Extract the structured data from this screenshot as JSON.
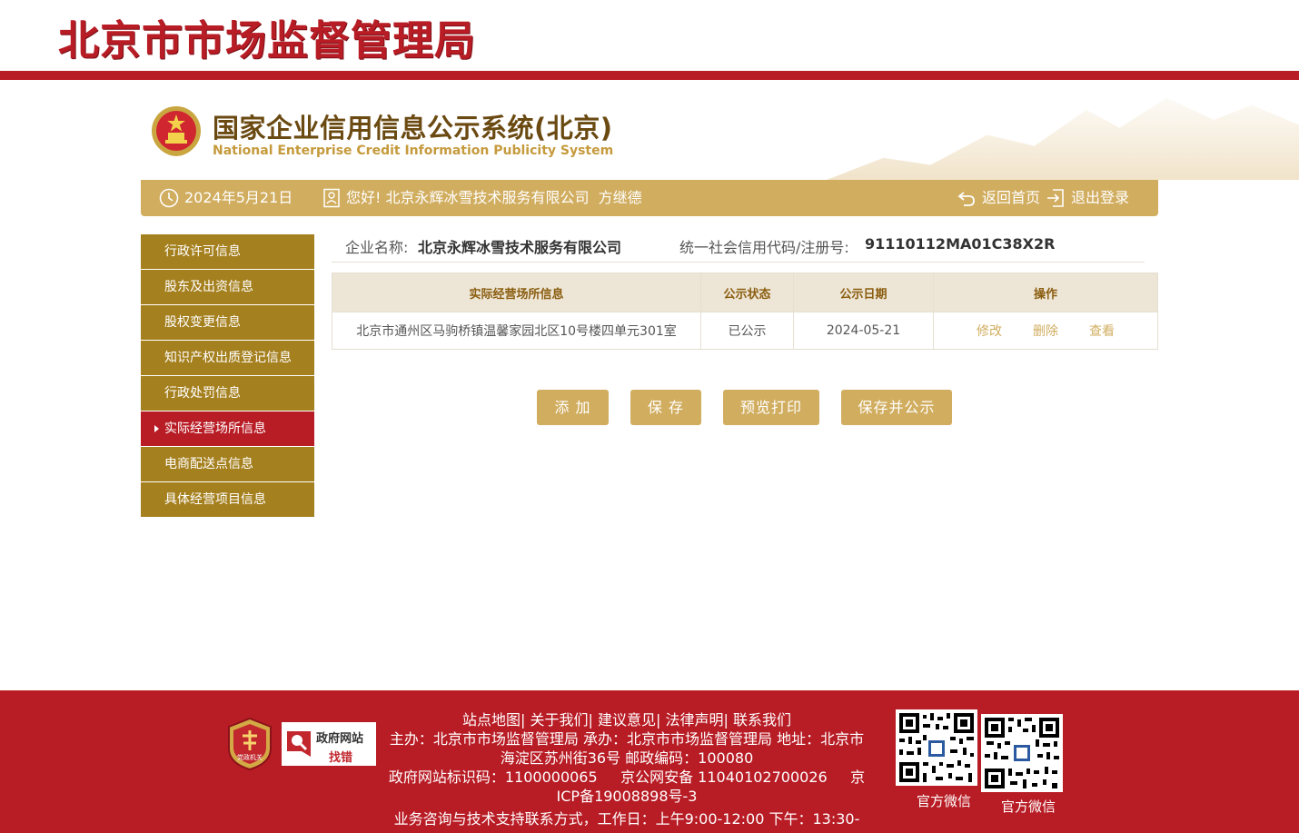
{
  "top_banner": {
    "title": "北京市市场监督管理局"
  },
  "system": {
    "title_cn": "国家企业信用信息公示系统(北京)",
    "title_en": "National Enterprise Credit Information Publicity System"
  },
  "info_bar": {
    "date": "2024年5月21日",
    "greeting": "您好! 北京永辉冰雪技术服务有限公司  方继德",
    "home_label": "返回首页",
    "logout_label": "退出登录"
  },
  "sidebar": {
    "items": [
      {
        "label": "行政许可信息",
        "active": false
      },
      {
        "label": "股东及出资信息",
        "active": false
      },
      {
        "label": "股权变更信息",
        "active": false
      },
      {
        "label": "知识产权出质登记信息",
        "active": false
      },
      {
        "label": "行政处罚信息",
        "active": false
      },
      {
        "label": "实际经营场所信息",
        "active": true
      },
      {
        "label": "电商配送点信息",
        "active": false
      },
      {
        "label": "具体经营项目信息",
        "active": false
      }
    ]
  },
  "company": {
    "name_label": "企业名称:",
    "name": "北京永辉冰雪技术服务有限公司",
    "code_label": "统一社会信用代码/注册号:",
    "code": "91110112MA01C38X2R"
  },
  "table": {
    "headers": [
      "实际经营场所信息",
      "公示状态",
      "公示日期",
      "操作"
    ],
    "rows": [
      {
        "address": "北京市通州区马驹桥镇温馨家园北区10号楼四单元301室",
        "status": "已公示",
        "date": "2024-05-21",
        "ops": [
          "修改",
          "删除",
          "查看"
        ]
      }
    ]
  },
  "buttons": {
    "add": "添 加",
    "save": "保 存",
    "preview": "预览打印",
    "save_publish": "保存并公示"
  },
  "footer": {
    "links": "站点地图| 关于我们| 建议意见| 法律声明| 联系我们",
    "host_line": "主办：北京市市场监督管理局 承办：北京市市场监督管理局 地址：北京市海淀区苏州街36号 邮政编码：100080",
    "id_line": "政府网站标识码：1100000065     京公网安备 11040102700026     京ICP备19008898号-3",
    "support_line": "业务咨询与技术支持联系方式，工作日：上午9:00-12:00 下午：13:30-",
    "badge_text": "党政机关",
    "error_box_title": "政府网站",
    "error_box_sub": "找错",
    "qr1_label": "官方微信",
    "qr2_label": "官方微信"
  },
  "colors": {
    "brand_red": "#b81c25",
    "gold": "#d1ad5f",
    "sidebar_gold": "#a5801f"
  }
}
